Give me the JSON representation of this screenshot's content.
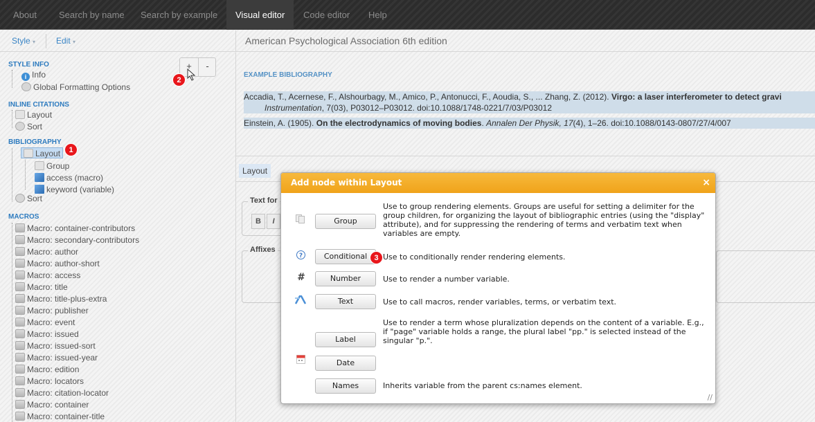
{
  "nav": {
    "tabs": [
      "About",
      "Search by name",
      "Search by example",
      "Visual editor",
      "Code editor",
      "Help"
    ],
    "active": "Visual editor"
  },
  "menubar": {
    "style": "Style",
    "edit": "Edit",
    "caret": "▾"
  },
  "style_title": "American Psychological Association 6th edition",
  "toolbar": {
    "add": "+",
    "remove": "-"
  },
  "tree": {
    "style_info": {
      "heading": "STYLE INFO",
      "info": "Info",
      "global": "Global Formatting Options"
    },
    "inline": {
      "heading": "INLINE CITATIONS",
      "layout": "Layout",
      "sort": "Sort"
    },
    "bibliography": {
      "heading": "BIBLIOGRAPHY",
      "layout": "Layout",
      "group": "Group",
      "access": "access (macro)",
      "keyword": "keyword (variable)",
      "sort": "Sort"
    },
    "macros": {
      "heading": "MACROS",
      "items": [
        "Macro: container-contributors",
        "Macro: secondary-contributors",
        "Macro: author",
        "Macro: author-short",
        "Macro: access",
        "Macro: title",
        "Macro: title-plus-extra",
        "Macro: publisher",
        "Macro: event",
        "Macro: issued",
        "Macro: issued-sort",
        "Macro: issued-year",
        "Macro: edition",
        "Macro: locators",
        "Macro: citation-locator",
        "Macro: container",
        "Macro: container-title"
      ]
    }
  },
  "badges": [
    "1",
    "2",
    "3"
  ],
  "example": {
    "label": "EXAMPLE BIBLIOGRAPHY",
    "entry1_a": "Accadia, T., Acernese, F., Alshourbagy, M., Amico, P., Antonucci, F., Aoudia, S., ... Zhang, Z. (2012). ",
    "entry1_b": "Virgo: a laser interferometer to detect gravi",
    "entry1_c": "Instrumentation",
    "entry1_d": ", 7(03), P03012–P03012. doi:10.1088/1748-0221/7/03/P03012",
    "entry2_a": "Einstein, A. (1905). ",
    "entry2_b": "On the electrodynamics of moving bodies",
    "entry2_c": ". ",
    "entry2_d": "Annalen Der Physik, 17",
    "entry2_e": "(4), 1–26. doi:10.1088/0143-0807/27/4/007"
  },
  "props": {
    "tab": "Layout",
    "text_format": "Text for",
    "affixes": "Affixes",
    "bold": "B",
    "italic": "I"
  },
  "dialog": {
    "title": "Add node within Layout",
    "close": "×",
    "grip": "//",
    "options": [
      {
        "label": "Group",
        "desc": "Use to group rendering elements. Groups are useful for setting a delimiter for the group children, for organizing the layout of bibliographic entries (using the \"display\" attribute), and for suppressing the rendering of terms and verbatim text when variables are empty.",
        "icon": "group-icon"
      },
      {
        "label": "Conditional",
        "desc": "Use to conditionally render rendering elements.",
        "icon": "question-icon"
      },
      {
        "label": "Number",
        "desc": "Use to render a number variable.",
        "icon": "hash-icon"
      },
      {
        "label": "Text",
        "desc": "Use to call macros, render variables, terms, or verbatim text.",
        "icon": "text-icon"
      },
      {
        "label": "Label",
        "desc": "Use to render a term whose pluralization depends on the content of a variable. E.g., if \"page\" variable holds a range, the plural label \"pp.\" is selected instead of the singular \"p.\".",
        "icon": ""
      },
      {
        "label": "Date",
        "desc": "",
        "icon": "calendar-icon"
      },
      {
        "label": "Names",
        "desc": "Inherits variable from the parent cs:names element.",
        "icon": ""
      }
    ]
  }
}
